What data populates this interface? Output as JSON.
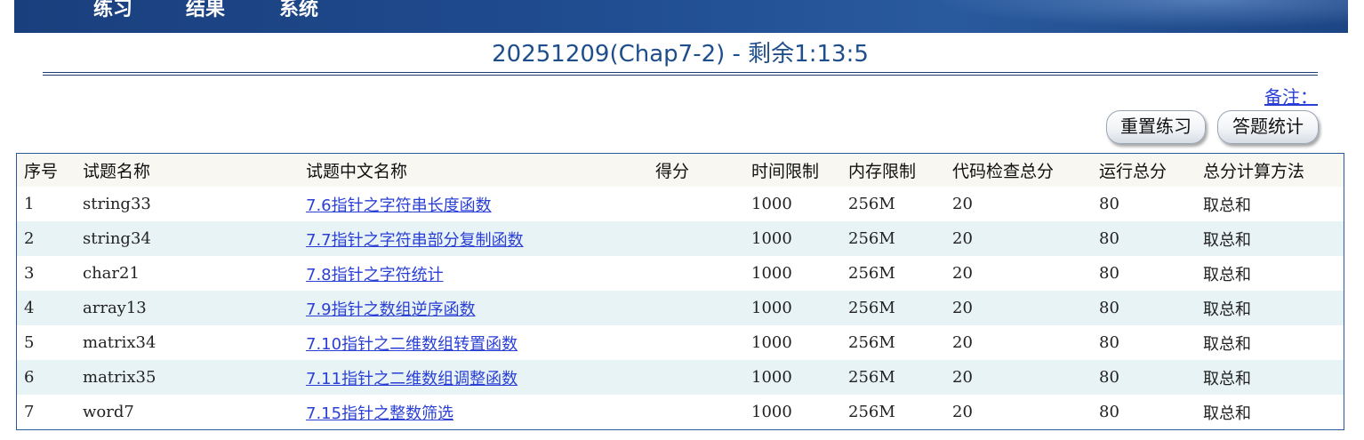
{
  "nav": {
    "items": [
      "练习",
      "结果",
      "系统"
    ]
  },
  "page": {
    "title": "20251209(Chap7-2) - 剩余1:13:5",
    "notes_link": "备注："
  },
  "actions": {
    "reset_label": "重置练习",
    "stats_label": "答题统计"
  },
  "table": {
    "headers": [
      "序号",
      "试题名称",
      "试题中文名称",
      "得分",
      "时间限制",
      "内存限制",
      "代码检查总分",
      "运行总分",
      "总分计算方法"
    ],
    "rows": [
      {
        "no": "1",
        "name": "string33",
        "cn_name": "7.6指针之字符串长度函数",
        "score": "",
        "time": "1000",
        "mem": "256M",
        "code_check": "20",
        "run": "80",
        "method": "取总和"
      },
      {
        "no": "2",
        "name": "string34",
        "cn_name": "7.7指针之字符串部分复制函数",
        "score": "",
        "time": "1000",
        "mem": "256M",
        "code_check": "20",
        "run": "80",
        "method": "取总和"
      },
      {
        "no": "3",
        "name": "char21",
        "cn_name": "7.8指针之字符统计",
        "score": "",
        "time": "1000",
        "mem": "256M",
        "code_check": "20",
        "run": "80",
        "method": "取总和"
      },
      {
        "no": "4",
        "name": "array13",
        "cn_name": "7.9指针之数组逆序函数",
        "score": "",
        "time": "1000",
        "mem": "256M",
        "code_check": "20",
        "run": "80",
        "method": "取总和"
      },
      {
        "no": "5",
        "name": "matrix34",
        "cn_name": "7.10指针之二维数组转置函数",
        "score": "",
        "time": "1000",
        "mem": "256M",
        "code_check": "20",
        "run": "80",
        "method": "取总和"
      },
      {
        "no": "6",
        "name": "matrix35",
        "cn_name": "7.11指针之二维数组调整函数",
        "score": "",
        "time": "1000",
        "mem": "256M",
        "code_check": "20",
        "run": "80",
        "method": "取总和"
      },
      {
        "no": "7",
        "name": "word7",
        "cn_name": "7.15指针之整数筛选",
        "score": "",
        "time": "1000",
        "mem": "256M",
        "code_check": "20",
        "run": "80",
        "method": "取总和"
      }
    ]
  },
  "colors": {
    "topbar": "#1f4b8f",
    "title": "#1f4e8c",
    "link": "#2a3fd6",
    "row_alt": "#e8f3f5"
  }
}
